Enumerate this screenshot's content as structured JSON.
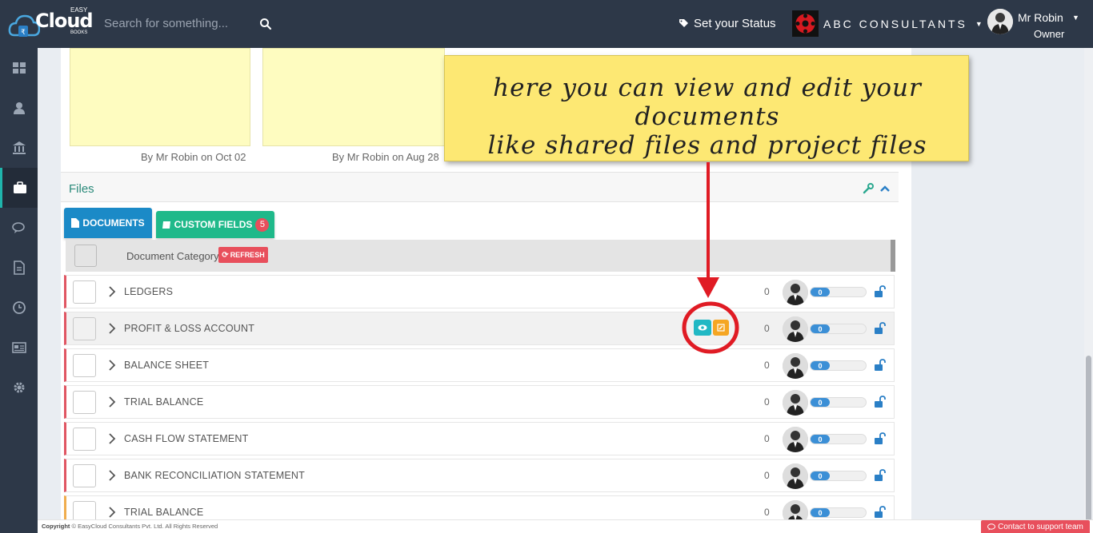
{
  "topbar": {
    "logo_main": "Cloud",
    "logo_easy": "EASY",
    "logo_books": "BOOKS",
    "search_placeholder": "Search for something...",
    "status_label": "Set your Status",
    "company_name": "ABC CONSULTANTS",
    "user_name": "Mr Robin",
    "user_role": "Owner"
  },
  "sidebar": {
    "items": [
      "dashboard-icon",
      "user-icon",
      "bank-icon",
      "briefcase-icon",
      "chat-icon",
      "document-icon",
      "clock-icon",
      "news-icon",
      "gear-icon"
    ],
    "active_index": 3
  },
  "notes": [
    {
      "caption": "By Mr Robin on Oct 02"
    },
    {
      "caption": "By Mr Robin on Aug 28"
    }
  ],
  "files": {
    "title": "Files",
    "tabs": {
      "documents": "DOCUMENTS",
      "custom_fields": "CUSTOM FIELDS",
      "custom_fields_badge": "5"
    },
    "header": {
      "category_label": "Document Category",
      "refresh_label": "REFRESH"
    },
    "rows": [
      {
        "name": "LEDGERS",
        "count": "0",
        "progress": "0"
      },
      {
        "name": "PROFIT & LOSS ACCOUNT",
        "count": "0",
        "progress": "0"
      },
      {
        "name": "BALANCE SHEET",
        "count": "0",
        "progress": "0"
      },
      {
        "name": "TRIAL BALANCE",
        "count": "0",
        "progress": "0"
      },
      {
        "name": "CASH FLOW STATEMENT",
        "count": "0",
        "progress": "0"
      },
      {
        "name": "BANK RECONCILIATION STATEMENT",
        "count": "0",
        "progress": "0"
      },
      {
        "name": "TRIAL BALANCE",
        "count": "0",
        "progress": "0"
      }
    ]
  },
  "callout": {
    "line1": "here you can view and edit your documents",
    "line2": "like shared files and project files"
  },
  "footer": {
    "copyright_label": "Copyright",
    "copyright_text": "© EasyCloud Consultants Pvt. Ltd. All Rights Reserved",
    "support_label": "Contact to support team"
  },
  "colors": {
    "topbar": "#2d3848",
    "accent_teal": "#1fb5ac",
    "docs_tab": "#1b8ac7",
    "custom_tab": "#1fb98a",
    "danger": "#e84f5c",
    "callout": "#fde873"
  }
}
